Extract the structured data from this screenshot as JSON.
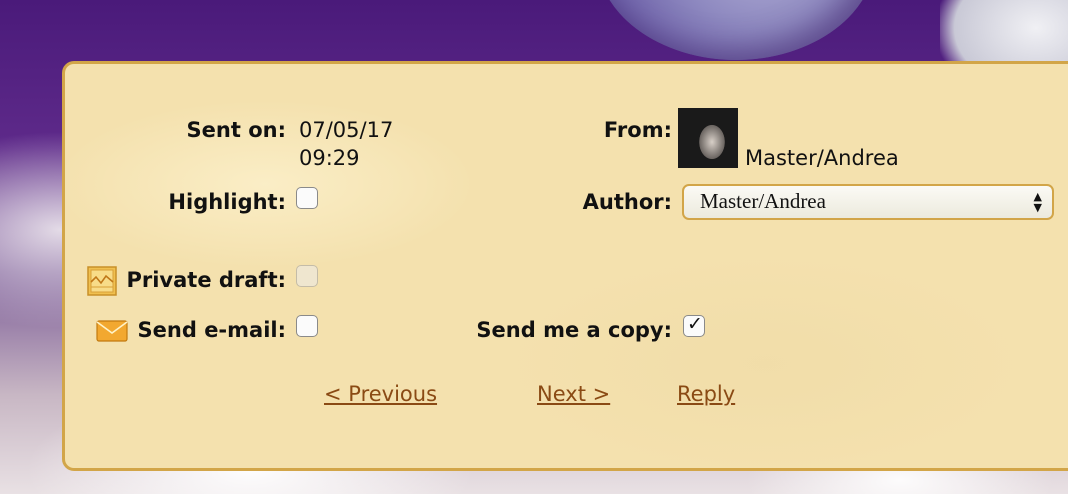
{
  "message": {
    "sent_on_label": "Sent on:",
    "sent_date": "07/05/17",
    "sent_time": "09:29",
    "from_label": "From:",
    "from_name": "Master/Andrea",
    "highlight_label": "Highlight:",
    "highlight_checked": false,
    "author_label": "Author:",
    "author_selected": "Master/Andrea",
    "private_draft_label": "Private draft:",
    "private_draft_checked": false,
    "private_draft_disabled": true,
    "send_email_label": "Send e-mail:",
    "send_email_checked": false,
    "send_copy_label": "Send me a copy:",
    "send_copy_checked": true
  },
  "nav": {
    "previous_label": "< Previous",
    "next_label": "Next >",
    "reply_label": "Reply"
  },
  "icons": {
    "draft": "draft-icon",
    "email": "envelope-icon",
    "avatar": "avatar"
  },
  "colors": {
    "panel_bg": "#f4e1ae",
    "panel_border": "#d2a548",
    "link": "#8a4a14",
    "background_purple": "#4a1a7a"
  }
}
